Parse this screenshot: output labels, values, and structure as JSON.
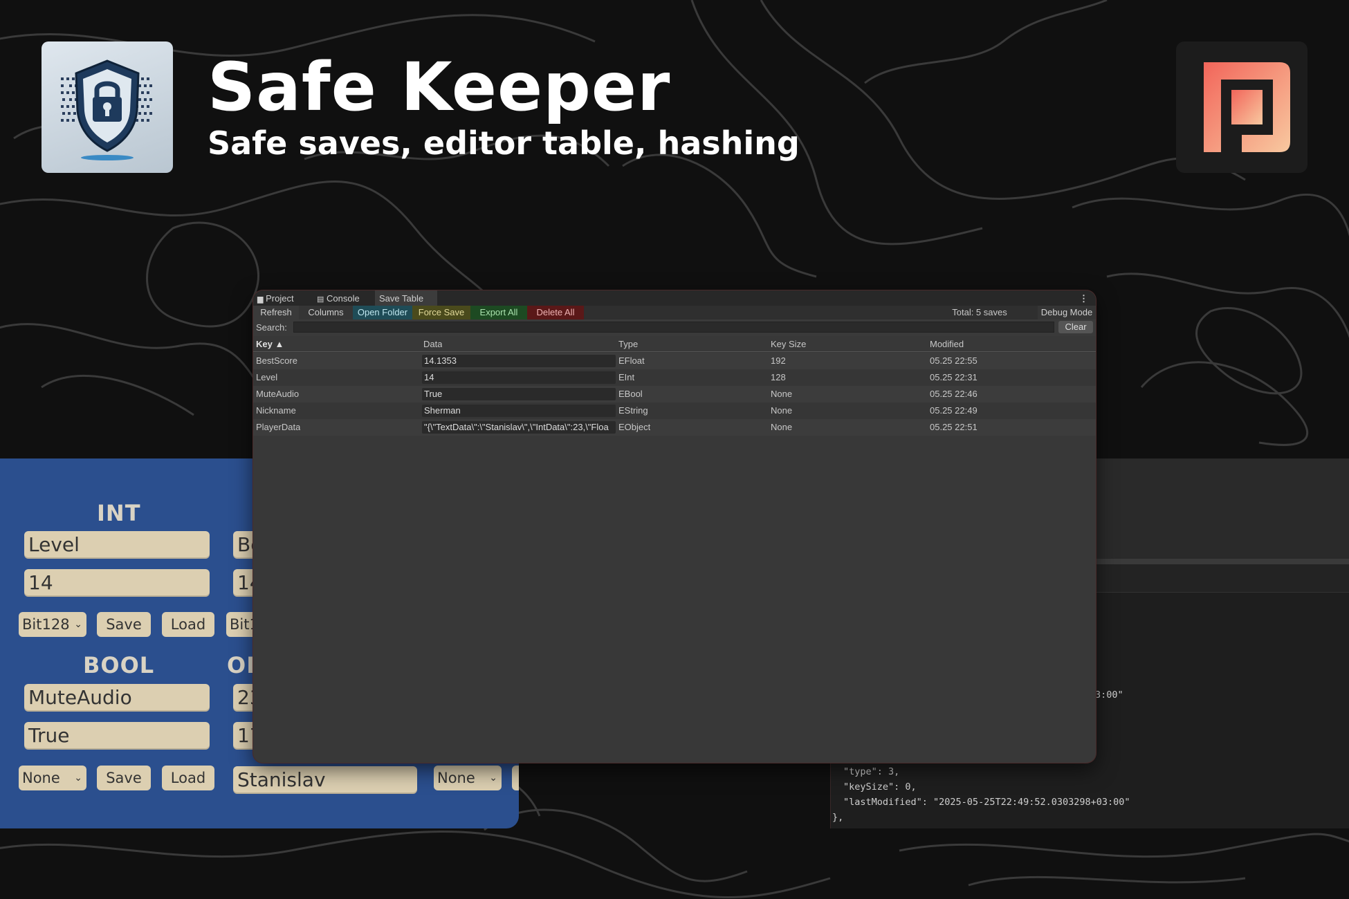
{
  "header": {
    "title": "Safe Keeper",
    "subtitle": "Safe saves, editor table, hashing"
  },
  "colors": {
    "accent_brand": "#f0735f",
    "panel_blue": "#2b4f8e",
    "field_tan": "#dccfb1"
  },
  "editor": {
    "tabs": [
      {
        "icon": "folder-icon",
        "label": "Project"
      },
      {
        "icon": "console-icon",
        "label": "Console"
      },
      {
        "label": "Save Table"
      }
    ],
    "toolbar": {
      "refresh": "Refresh",
      "columns": "Columns",
      "open_folder": "Open Folder",
      "force_save": "Force Save",
      "export_all": "Export All",
      "delete_all": "Delete All",
      "total": "Total: 5 saves",
      "debug_mode": "Debug Mode"
    },
    "search": {
      "label": "Search:",
      "clear": "Clear"
    },
    "columns": [
      "Key ▲",
      "Data",
      "Type",
      "Key Size",
      "Modified"
    ],
    "rows": [
      {
        "key": "BestScore",
        "data": "14.1353",
        "type": "EFloat",
        "key_size": "192",
        "modified": "05.25 22:55"
      },
      {
        "key": "Level",
        "data": "14",
        "type": "EInt",
        "key_size": "128",
        "modified": "05.25 22:31"
      },
      {
        "key": "MuteAudio",
        "data": "True",
        "type": "EBool",
        "key_size": "None",
        "modified": "05.25 22:46"
      },
      {
        "key": "Nickname",
        "data": "Sherman",
        "type": "EString",
        "key_size": "None",
        "modified": "05.25 22:49"
      },
      {
        "key": "PlayerData",
        "data": "\"{\\\"TextData\\\":\\\"Stanislav\\\",\\\"IntData\\\":23,\\\"Floa",
        "type": "EObject",
        "key_size": "None",
        "modified": "05.25 22:51"
      }
    ]
  },
  "game_panel": {
    "int_header": "INT",
    "int_key": "Level",
    "int_value": "14",
    "int_select": "Bit128",
    "save": "Save",
    "load": "Load",
    "col2_key_partial": "Be",
    "col2_value_partial": "14",
    "col2_select_partial": "Bit1",
    "bool_header": "BOOL",
    "bool_key": "MuteAudio",
    "bool_value": "True",
    "bool_select": "None",
    "obj_header_partial": "OB",
    "obj_field1_partial": "23",
    "obj_field2_partial": "17",
    "obj_text": "Stanislav",
    "obj_select": "None"
  },
  "json_console": {
    "line_partial": "3:00\"",
    "type_line": "\"type\": 3,",
    "keysize_line": "\"keySize\": 0,",
    "lastmod_line": "\"lastModified\": \"2025-05-25T22:49:52.0303298+03:00\"",
    "close_line": "},"
  }
}
